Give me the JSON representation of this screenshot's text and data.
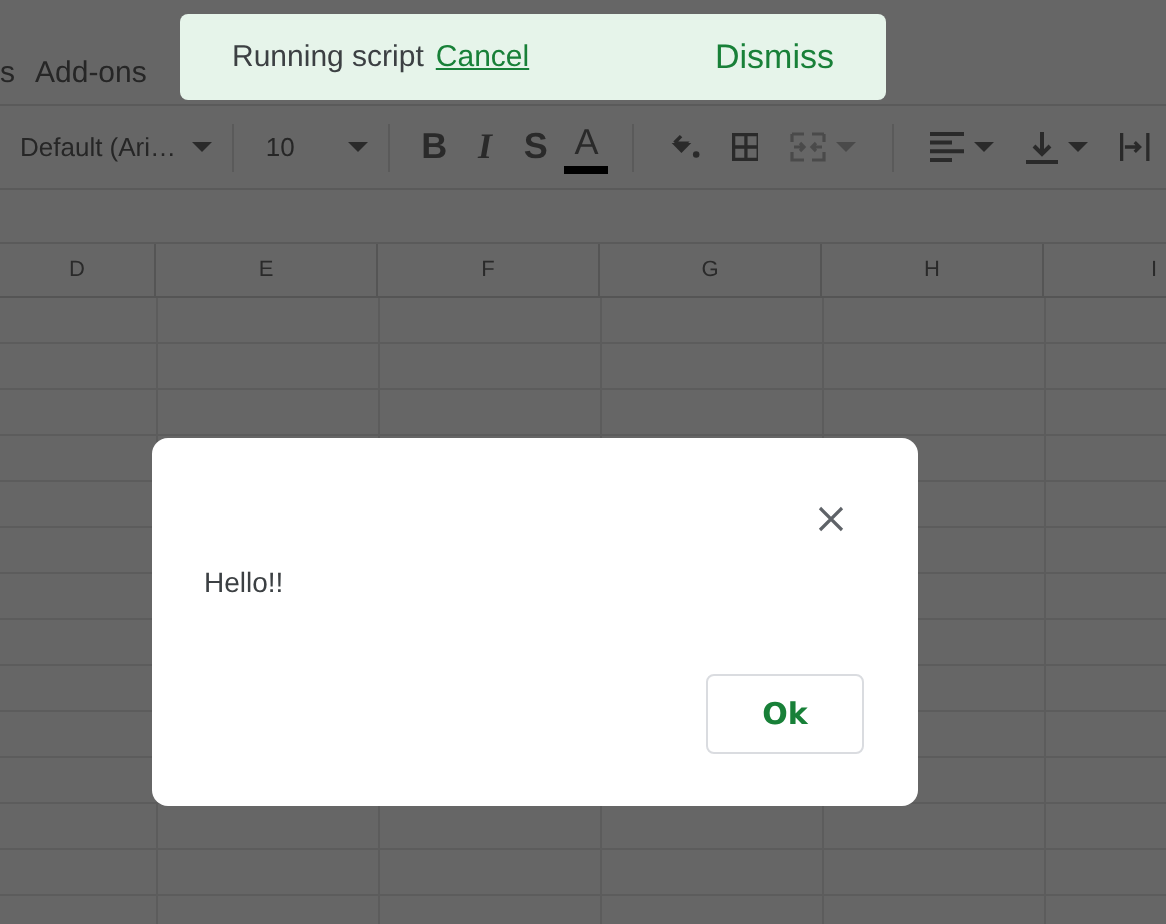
{
  "menu": {
    "items": [
      "s",
      "Add-ons"
    ]
  },
  "toolbar": {
    "font": "Default (Ari…",
    "size": "10",
    "format_buttons": [
      {
        "kind": "bold",
        "label": "B"
      },
      {
        "kind": "italic",
        "label": "I"
      },
      {
        "kind": "strike",
        "label": "S"
      },
      {
        "kind": "color",
        "label": "A"
      }
    ],
    "merge": {
      "disabled": true
    }
  },
  "columns": [
    "D",
    "E",
    "F",
    "G",
    "H",
    "I"
  ],
  "toast": {
    "message": "Running script",
    "link": "Cancel",
    "action": "Dismiss"
  },
  "dialog": {
    "message": "Hello!!",
    "button": "Ok"
  }
}
